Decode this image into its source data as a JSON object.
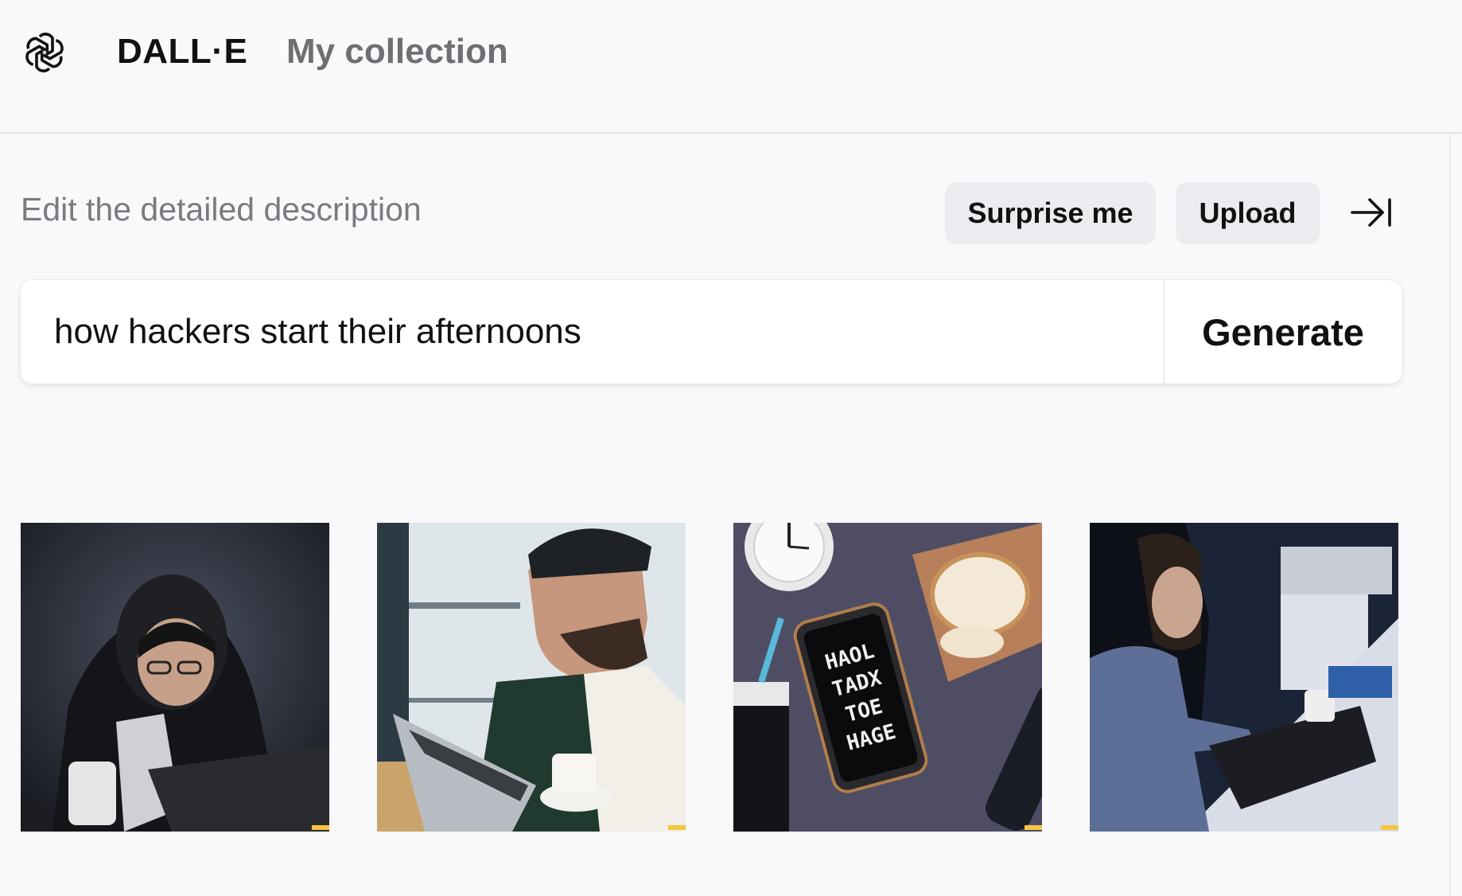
{
  "header": {
    "brand": "DALL·E",
    "nav_collection": "My collection"
  },
  "editor": {
    "heading": "Edit the detailed description",
    "surprise_label": "Surprise me",
    "upload_label": "Upload",
    "prompt_value": "how hackers start their afternoons",
    "generate_label": "Generate"
  },
  "results": {
    "images": [
      {
        "subject": "hooded person at laptop in dark room with mug"
      },
      {
        "subject": "bearded man in beanie typing on laptop with coffee cup"
      },
      {
        "subject": "phone, clock, bread and cup on dark table"
      },
      {
        "subject": "woman typing on laptop at desk in dim room"
      }
    ],
    "phone_screen_text": [
      "HAOL",
      "TADX",
      "TOE",
      "HAGE"
    ]
  },
  "colors": {
    "background": "#f9f9fb",
    "button_bg": "#ececf0",
    "muted_text": "#7a7a80"
  }
}
